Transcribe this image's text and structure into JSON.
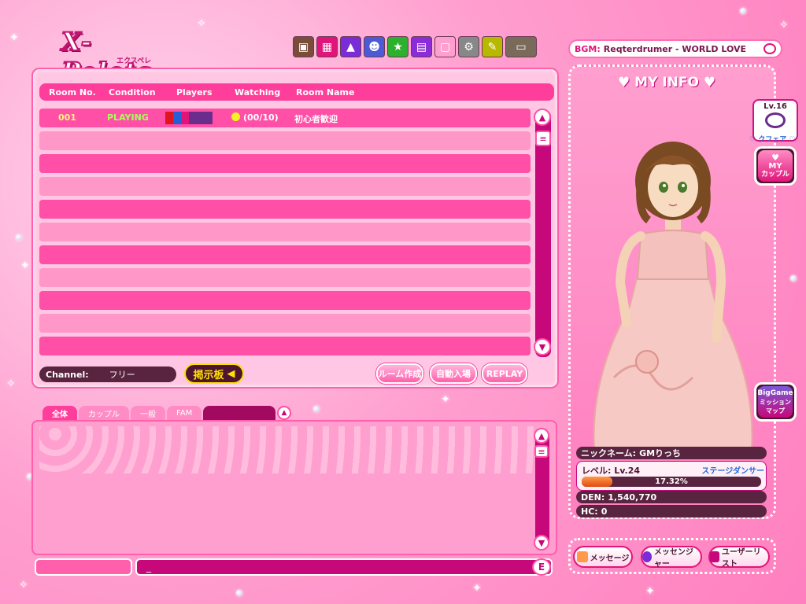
{
  "app": {
    "logo": "X-Pelets",
    "logo_sub": "エクスペレ"
  },
  "toolbar": {
    "icons": [
      "purple-box-icon",
      "gift-icon",
      "shirt-icon",
      "face-icon",
      "star-icon",
      "tv-icon",
      "pink-icon",
      "gear-icon",
      "note-icon",
      "store-icon"
    ]
  },
  "bgm": {
    "label": "BGM:",
    "track": "Reqterdrumer - WORLD LOVE"
  },
  "room_list": {
    "headers": {
      "room_no": "Room No.",
      "condition": "Condition",
      "players": "Players",
      "watching": "Watching",
      "room_name": "Room Name"
    },
    "rooms": [
      {
        "room_no": "001",
        "condition": "PLAYING",
        "watching": "(00/10)",
        "room_name": "初心者歓迎"
      }
    ],
    "player_colors": [
      "#e0151f",
      "#2660d6",
      "#e0157a",
      "#6a2d8c",
      "#6a2d8c",
      "#6a2d8c"
    ]
  },
  "channel": {
    "label": "Channel:",
    "value": "フリー"
  },
  "buttons": {
    "bbs": "掲示板",
    "create_room": "ルーム作成",
    "auto_join": "自動入場",
    "replay": "REPLAY"
  },
  "chat": {
    "tabs": [
      "全体",
      "カップル",
      "一般",
      "FAM"
    ],
    "input_value": "_"
  },
  "my_info": {
    "title": "MY INFO",
    "badge_level": "Lv.16",
    "badge_label": "クフェア",
    "my_couple": [
      "MY",
      "カップル"
    ],
    "big_game": [
      "BigGame",
      "ミッション",
      "マップ"
    ],
    "nickname_label": "ニックネーム:",
    "nickname": "GMりっち",
    "level_label": "レベル:",
    "level": "Lv.24",
    "class": "ステージダンサー",
    "xp_percent_text": "17.32%",
    "xp_fraction": 0.1732,
    "den_label": "DEN:",
    "den": "1,540,770",
    "hc_label": "HC:",
    "hc": "0"
  },
  "bottom_buttons": {
    "message": "メッセージ",
    "messenger": "メッセンジャー",
    "user_list": "ユーザーリスト"
  }
}
